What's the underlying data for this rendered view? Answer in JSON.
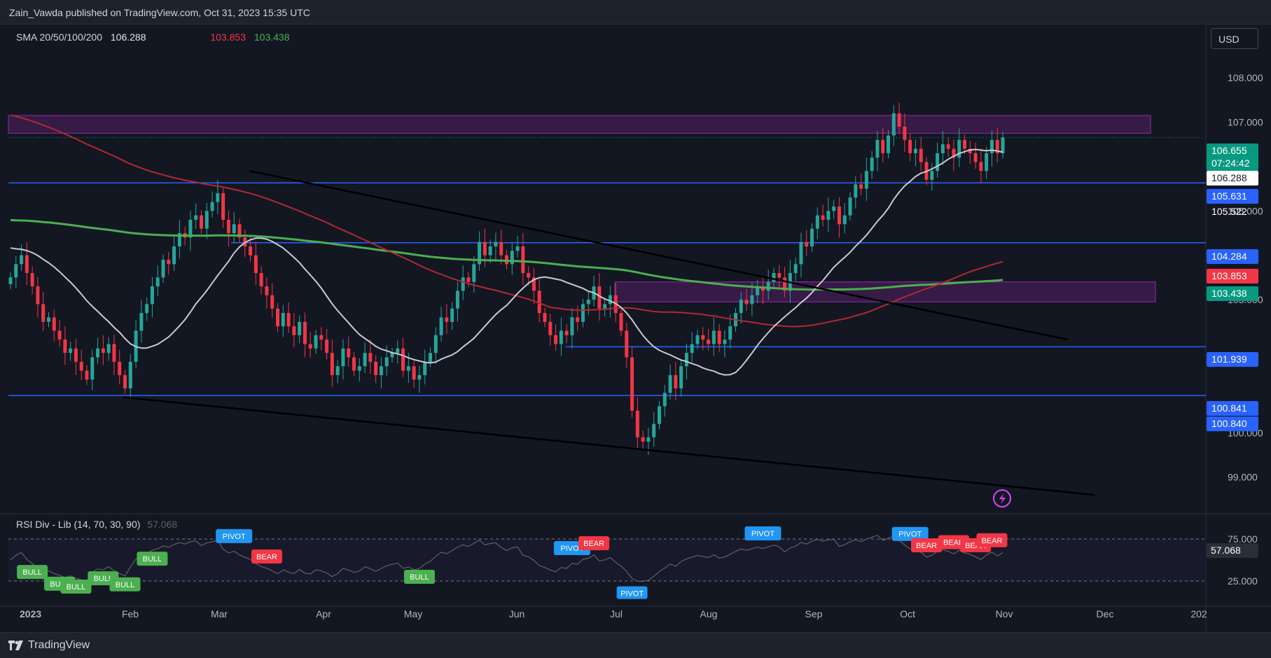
{
  "header": {
    "text": "Zain_Vawda published on TradingView.com, Oct 31, 2023 15:35 UTC"
  },
  "currency_button": "USD",
  "legend": {
    "sma_label": "SMA 20/50/100/200",
    "sma_values": [
      {
        "value": "106.288",
        "color": "#e0e3eb"
      },
      {
        "value": "103.853",
        "color": "#f23645"
      },
      {
        "value": "103.438",
        "color": "#4caf50"
      }
    ],
    "rsi_label": "RSI Div - Lib (14, 70, 30, 90)",
    "rsi_value": "57.068"
  },
  "footer": {
    "brand": "TradingView"
  },
  "colors": {
    "bg": "#131722",
    "up": "#26a69a",
    "down": "#f23645",
    "hline": "#2962ff",
    "zone": "#9c27b0",
    "sma_white": "#c8cbd2",
    "sma_red": "#b22833",
    "sma_green": "#4caf50"
  },
  "chart_data": [
    {
      "type": "candlestick",
      "symbol_note": "US Dollar Index, daily",
      "x_tick_labels": [
        "2023",
        "Feb",
        "Mar",
        "Apr",
        "May",
        "Jun",
        "Jul",
        "Aug",
        "Sep",
        "Oct",
        "Nov",
        "Dec",
        "202"
      ],
      "y_tick_labels": [
        "108.000",
        "107.000",
        "105.000",
        "103.000",
        "100.000",
        "99.000"
      ],
      "ylim": [
        98.55,
        108.95
      ],
      "price_labels": [
        {
          "text": "106.655",
          "bg": "#089981",
          "fg": "#ffffff"
        },
        {
          "text": "07:24:42",
          "bg": "#089981",
          "fg": "#ffffff"
        },
        {
          "text": "106.288",
          "bg": "#ffffff",
          "fg": "#131722"
        },
        {
          "text": "105.631",
          "bg": "#2962ff",
          "fg": "#ffffff"
        },
        {
          "text": "105.522",
          "bg": "",
          "fg": "#ffffff"
        },
        {
          "text": "104.284",
          "bg": "#2962ff",
          "fg": "#ffffff"
        },
        {
          "text": "103.853",
          "bg": "#f23645",
          "fg": "#ffffff"
        },
        {
          "text": "103.438",
          "bg": "#089981",
          "fg": "#ffffff"
        },
        {
          "text": "101.939",
          "bg": "#2962ff",
          "fg": "#ffffff"
        },
        {
          "text": "100.841",
          "bg": "#2962ff",
          "fg": "#ffffff"
        },
        {
          "text": "100.840",
          "bg": "#2962ff",
          "fg": "#ffffff"
        }
      ],
      "horizontal_levels": [
        105.631,
        104.284,
        101.939,
        100.841
      ],
      "zones": [
        [
          106.75,
          107.15
        ],
        [
          102.95,
          103.4
        ]
      ],
      "trendlines": [
        {
          "from": [
            "Mar 10",
            105.9
          ],
          "to": [
            "Nov 20",
            102.1
          ]
        },
        {
          "from": [
            "Jan 30",
            100.8
          ],
          "to": [
            "Nov 28",
            98.6
          ]
        }
      ],
      "closes": [
        103.5,
        103.8,
        104.0,
        103.6,
        103.3,
        102.9,
        102.5,
        102.6,
        102.3,
        102.1,
        101.8,
        101.9,
        101.6,
        101.4,
        101.2,
        101.7,
        101.9,
        101.8,
        102.0,
        101.6,
        101.3,
        101.0,
        101.6,
        102.3,
        102.7,
        102.9,
        103.3,
        103.5,
        103.9,
        103.8,
        104.2,
        104.5,
        104.4,
        104.8,
        104.9,
        104.6,
        105.0,
        105.2,
        105.4,
        104.8,
        104.5,
        104.7,
        104.4,
        104.2,
        104.0,
        103.6,
        103.3,
        103.1,
        102.8,
        102.4,
        102.7,
        102.4,
        102.2,
        102.5,
        102.0,
        101.9,
        102.2,
        102.1,
        101.8,
        101.3,
        101.5,
        101.9,
        101.7,
        101.4,
        101.5,
        101.8,
        101.6,
        101.3,
        101.5,
        101.7,
        101.8,
        101.9,
        101.4,
        101.5,
        101.2,
        101.3,
        101.6,
        101.8,
        102.2,
        102.6,
        102.5,
        102.8,
        103.2,
        103.5,
        103.4,
        103.8,
        104.3,
        104.0,
        104.2,
        104.3,
        104.0,
        103.8,
        104.1,
        104.2,
        103.6,
        103.5,
        103.2,
        102.7,
        102.5,
        102.2,
        102.0,
        102.3,
        102.2,
        102.6,
        102.5,
        102.9,
        103.0,
        103.3,
        102.8,
        102.9,
        103.1,
        102.7,
        102.3,
        101.7,
        100.5,
        99.9,
        99.8,
        99.9,
        100.2,
        100.6,
        100.9,
        101.3,
        101.0,
        101.5,
        101.8,
        102.0,
        102.2,
        102.1,
        102.0,
        102.3,
        102.0,
        102.1,
        102.4,
        102.7,
        103.0,
        102.9,
        103.1,
        103.3,
        103.2,
        103.4,
        103.6,
        103.5,
        103.2,
        103.6,
        103.8,
        104.3,
        104.2,
        104.6,
        104.9,
        104.8,
        105.0,
        105.1,
        104.7,
        104.9,
        105.3,
        105.6,
        105.5,
        105.9,
        106.2,
        106.6,
        106.3,
        106.7,
        107.2,
        106.9,
        106.6,
        106.3,
        106.4,
        106.1,
        105.7,
        105.9,
        106.3,
        106.5,
        106.4,
        106.2,
        106.6,
        106.4,
        106.3,
        106.1,
        105.9,
        106.3,
        106.6,
        106.3,
        106.655
      ]
    },
    {
      "type": "line",
      "name": "RSI Div - Lib (14, 70, 30, 90)",
      "ylim": [
        10,
        90
      ],
      "y_tick_labels": [
        "75.000",
        "25.000"
      ],
      "current_value": "57.068",
      "signals": [
        {
          "text": "BULL",
          "kind": "bull",
          "idx": 4
        },
        {
          "text": "BULL",
          "kind": "bull",
          "idx": 9
        },
        {
          "text": "BULL",
          "kind": "bull",
          "idx": 12
        },
        {
          "text": "BULL",
          "kind": "bull",
          "idx": 17
        },
        {
          "text": "BULL",
          "kind": "bull",
          "idx": 21
        },
        {
          "text": "BULL",
          "kind": "bull",
          "idx": 26
        },
        {
          "text": "PIVOT",
          "kind": "pivot",
          "idx": 41
        },
        {
          "text": "BEAR",
          "kind": "bear",
          "idx": 47
        },
        {
          "text": "BULL",
          "kind": "bull",
          "idx": 75
        },
        {
          "text": "PIVOT",
          "kind": "pivot",
          "idx": 103
        },
        {
          "text": "BEAR",
          "kind": "bear",
          "idx": 107
        },
        {
          "text": "PIVOT",
          "kind": "pivot",
          "idx": 138
        },
        {
          "text": "PIVOT",
          "kind": "pivot",
          "idx": 165
        },
        {
          "text": "BEAR",
          "kind": "bear",
          "idx": 168
        },
        {
          "text": "BEAR",
          "kind": "bear",
          "idx": 173
        },
        {
          "text": "BEAR",
          "kind": "bear",
          "idx": 177
        },
        {
          "text": "BEAR",
          "kind": "bear",
          "idx": 180
        },
        {
          "text": "BEAR",
          "kind": "bear",
          "idx": 184
        },
        {
          "text": "PIVOT",
          "kind": "pivot",
          "idx": 188
        },
        {
          "text": "BEAR",
          "kind": "bear",
          "idx": 192
        }
      ]
    }
  ]
}
